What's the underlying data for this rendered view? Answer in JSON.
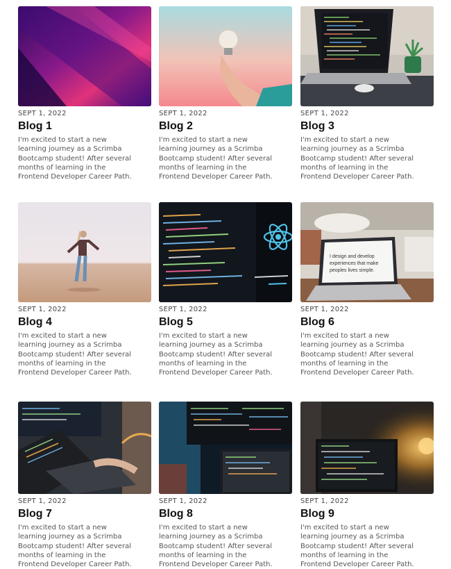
{
  "posts": [
    {
      "date": "SEPT 1, 2022",
      "title": "Blog 1",
      "excerpt": "I'm excited to start a new learning journey as a Scrimba Bootcamp student! After several months of learning in the Frontend Developer Career Path.",
      "image": "purple-abstract-building"
    },
    {
      "date": "SEPT 1, 2022",
      "title": "Blog 2",
      "excerpt": "I'm excited to start a new learning journey as a Scrimba Bootcamp student! After several months of learning in the Frontend Developer Career Path.",
      "image": "hand-holding-lightbulb"
    },
    {
      "date": "SEPT 1, 2022",
      "title": "Blog 3",
      "excerpt": "I'm excited to start a new learning journey as a Scrimba Bootcamp student! After several months of learning in the Frontend Developer Career Path.",
      "image": "laptop-with-code-and-plant"
    },
    {
      "date": "SEPT 1, 2022",
      "title": "Blog 4",
      "excerpt": "I'm excited to start a new learning journey as a Scrimba Bootcamp student! After several months of learning in the Frontend Developer Career Path.",
      "image": "woman-on-beach"
    },
    {
      "date": "SEPT 1, 2022",
      "title": "Blog 5",
      "excerpt": "I'm excited to start a new learning journey as a Scrimba Bootcamp student! After several months of learning in the Frontend Developer Career Path.",
      "image": "react-logo-code-screen"
    },
    {
      "date": "SEPT 1, 2022",
      "title": "Blog 6",
      "excerpt": "I'm excited to start a new learning journey as a Scrimba Bootcamp student! After several months of learning in the Frontend Developer Career Path.",
      "image": "laptop-on-desk"
    },
    {
      "date": "SEPT 1, 2022",
      "title": "Blog 7",
      "excerpt": "I'm excited to start a new learning journey as a Scrimba Bootcamp student! After several months of learning in the Frontend Developer Career Path.",
      "image": "person-typing-laptop"
    },
    {
      "date": "SEPT 1, 2022",
      "title": "Blog 8",
      "excerpt": "I'm excited to start a new learning journey as a Scrimba Bootcamp student! After several months of learning in the Frontend Developer Career Path.",
      "image": "dark-desk-monitors"
    },
    {
      "date": "SEPT 1, 2022",
      "title": "Blog 9",
      "excerpt": "I'm excited to start a new learning journey as a Scrimba Bootcamp student! After several months of learning in the Frontend Developer Career Path.",
      "image": "laptop-dark-room-lamp"
    }
  ],
  "image_text": {
    "laptop_screen_line1": "I design and develop",
    "laptop_screen_line2": "experiences that make",
    "laptop_screen_line3": "peoples lives simple."
  }
}
